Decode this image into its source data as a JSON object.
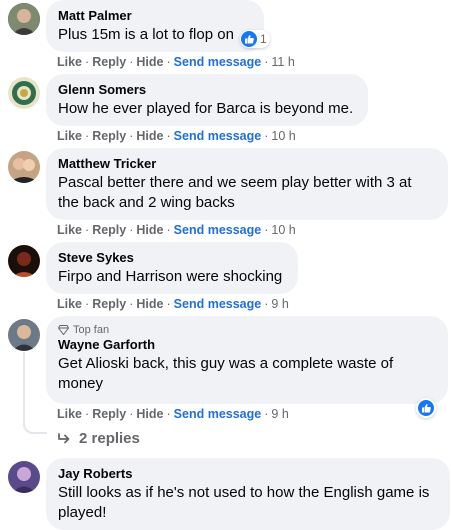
{
  "comments": [
    {
      "name": "Matt Palmer",
      "text": "Plus 15m is a lot to flop on",
      "reaction_count": "1",
      "actions": {
        "like": "Like",
        "reply": "Reply",
        "hide": "Hide",
        "send": "Send message",
        "time": "11 h"
      }
    },
    {
      "name": "Glenn Somers",
      "text": "How he ever played for Barca is beyond me.",
      "actions": {
        "like": "Like",
        "reply": "Reply",
        "hide": "Hide",
        "send": "Send message",
        "time": "10 h"
      }
    },
    {
      "name": "Matthew Tricker",
      "text_line1": "Pascal better there and we seem play better with 3 at",
      "text_line2": "the back and 2 wing backs",
      "actions": {
        "like": "Like",
        "reply": "Reply",
        "hide": "Hide",
        "send": "Send message",
        "time": "10 h"
      }
    },
    {
      "name": "Steve Sykes",
      "text": "Firpo and Harrison were shocking",
      "actions": {
        "like": "Like",
        "reply": "Reply",
        "hide": "Hide",
        "send": "Send message",
        "time": "9 h"
      }
    },
    {
      "badge": "Top fan",
      "name": "Wayne Garforth",
      "text_line1": "Get Alioski back, this guy was a complete waste of",
      "text_line2": "money",
      "actions": {
        "like": "Like",
        "reply": "Reply",
        "hide": "Hide",
        "send": "Send message",
        "time": "9 h"
      },
      "replies": "2 replies"
    },
    {
      "name": "Jay Roberts",
      "text_line1": "Still looks as if he's not used to how the English game is",
      "text_line2": "played!"
    }
  ],
  "colors": {
    "link": "#216fdb",
    "bubble": "#f0f2f5",
    "muted": "#65676b",
    "like": "#1877f2"
  },
  "icons": [
    "like-icon",
    "diamond-icon",
    "reply-arrow-icon"
  ]
}
